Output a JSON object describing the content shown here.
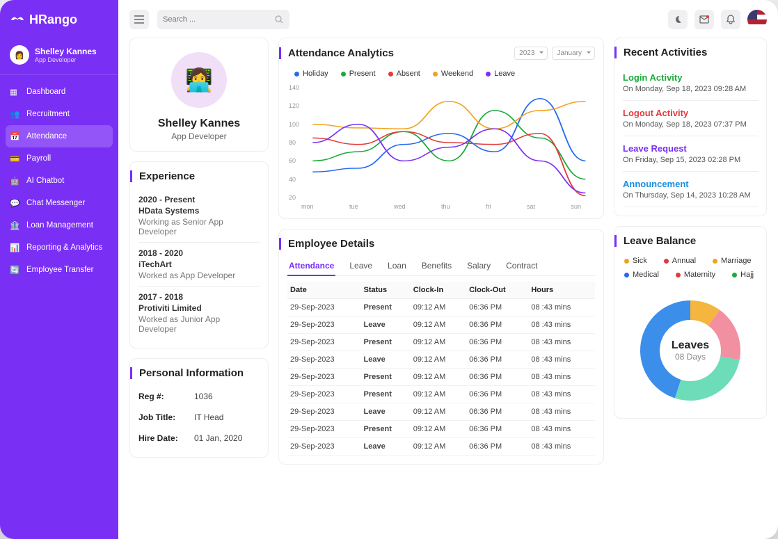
{
  "brand": "HRango",
  "user": {
    "name": "Shelley Kannes",
    "role": "App Developer"
  },
  "nav": {
    "items": [
      {
        "label": "Dashboard"
      },
      {
        "label": "Recruitment"
      },
      {
        "label": "Attendance",
        "active": true
      },
      {
        "label": "Payroll"
      },
      {
        "label": "AI Chatbot"
      },
      {
        "label": "Chat Messenger"
      },
      {
        "label": "Loan Management"
      },
      {
        "label": "Reporting & Analytics"
      },
      {
        "label": "Employee Transfer"
      }
    ]
  },
  "search": {
    "placeholder": "Search ..."
  },
  "profile": {
    "name": "Shelley Kannes",
    "role": "App Developer"
  },
  "experience": {
    "title": "Experience",
    "items": [
      {
        "dates": "2020 - Present",
        "company": "HData Systems",
        "desc": "Working as Senior App Developer"
      },
      {
        "dates": "2018 - 2020",
        "company": "iTechArt",
        "desc": "Worked as App Developer"
      },
      {
        "dates": "2017 - 2018",
        "company": "Protiviti Limited",
        "desc": "Worked as Junior App Developer"
      }
    ]
  },
  "personal": {
    "title": "Personal Information",
    "rows": [
      {
        "label": "Reg #:",
        "value": "1036"
      },
      {
        "label": "Job Title:",
        "value": "IT Head"
      },
      {
        "label": "Hire Date:",
        "value": "01 Jan, 2020"
      }
    ]
  },
  "attendance": {
    "title": "Attendance Analytics",
    "year": "2023",
    "month": "January",
    "legend": [
      {
        "label": "Holiday",
        "color": "#2668f0"
      },
      {
        "label": "Present",
        "color": "#1aaa3b"
      },
      {
        "label": "Absent",
        "color": "#e23a3a"
      },
      {
        "label": "Weekend",
        "color": "#f0a21e"
      },
      {
        "label": "Leave",
        "color": "#7a2ff5"
      }
    ]
  },
  "chart_data": {
    "type": "line",
    "categories": [
      "mon",
      "tue",
      "wed",
      "thu",
      "fri",
      "sat",
      "sun"
    ],
    "ylim": [
      20,
      140
    ],
    "yticks": [
      20,
      40,
      60,
      80,
      100,
      120,
      140
    ],
    "series": [
      {
        "name": "Holiday",
        "color": "#2668f0",
        "values": [
          48,
          52,
          78,
          90,
          70,
          128,
          60
        ]
      },
      {
        "name": "Present",
        "color": "#1aaa3b",
        "values": [
          60,
          70,
          92,
          60,
          115,
          85,
          40
        ]
      },
      {
        "name": "Absent",
        "color": "#e23a3a",
        "values": [
          85,
          78,
          92,
          80,
          78,
          90,
          22
        ]
      },
      {
        "name": "Weekend",
        "color": "#f0a21e",
        "values": [
          100,
          96,
          95,
          125,
          95,
          115,
          125
        ]
      },
      {
        "name": "Leave",
        "color": "#7a2ff5",
        "values": [
          80,
          100,
          60,
          75,
          95,
          60,
          25
        ]
      }
    ]
  },
  "details": {
    "title": "Employee Details",
    "tabs": [
      "Attendance",
      "Leave",
      "Loan",
      "Benefits",
      "Salary",
      "Contract"
    ],
    "activeTab": 0,
    "columns": [
      "Date",
      "Status",
      "Clock-In",
      "Clock-Out",
      "Hours"
    ],
    "rows": [
      {
        "date": "29-Sep-2023",
        "status": "Present",
        "in": "09:12 AM",
        "out": "06:36 PM",
        "hours": "08 :43 mins"
      },
      {
        "date": "29-Sep-2023",
        "status": "Leave",
        "in": "09:12 AM",
        "out": "06:36 PM",
        "hours": "08 :43 mins"
      },
      {
        "date": "29-Sep-2023",
        "status": "Present",
        "in": "09:12 AM",
        "out": "06:36 PM",
        "hours": "08 :43 mins"
      },
      {
        "date": "29-Sep-2023",
        "status": "Leave",
        "in": "09:12 AM",
        "out": "06:36 PM",
        "hours": "08 :43 mins"
      },
      {
        "date": "29-Sep-2023",
        "status": "Present",
        "in": "09:12 AM",
        "out": "06:36 PM",
        "hours": "08 :43 mins"
      },
      {
        "date": "29-Sep-2023",
        "status": "Present",
        "in": "09:12 AM",
        "out": "06:36 PM",
        "hours": "08 :43 mins"
      },
      {
        "date": "29-Sep-2023",
        "status": "Leave",
        "in": "09:12 AM",
        "out": "06:36 PM",
        "hours": "08 :43 mins"
      },
      {
        "date": "29-Sep-2023",
        "status": "Present",
        "in": "09:12 AM",
        "out": "06:36 PM",
        "hours": "08 :43 mins"
      },
      {
        "date": "29-Sep-2023",
        "status": "Leave",
        "in": "09:12 AM",
        "out": "06:36 PM",
        "hours": "08 :43 mins"
      }
    ]
  },
  "activities": {
    "title": "Recent Activities",
    "items": [
      {
        "title": "Login Activity",
        "color": "#1aaa3b",
        "sub": "On Monday, Sep 18, 2023  09:28 AM"
      },
      {
        "title": "Logout Activity",
        "color": "#e23a3a",
        "sub": "On Monday, Sep 18, 2023  07:37 PM"
      },
      {
        "title": "Leave Request",
        "color": "#7a2ff5",
        "sub": "On Friday, Sep 15, 2023  02:28 PM"
      },
      {
        "title": "Announcement",
        "color": "#1a8fe0",
        "sub": "On Thursday, Sep 14, 2023  10:28 AM"
      }
    ]
  },
  "leave": {
    "title": "Leave Balance",
    "center_title": "Leaves",
    "center_sub": "08 Days",
    "legend": [
      {
        "label": "Sick",
        "color": "#f0a21e"
      },
      {
        "label": "Annual",
        "color": "#e23a3a"
      },
      {
        "label": "Marriage",
        "color": "#f0a21e"
      },
      {
        "label": "Medical",
        "color": "#2668f0"
      },
      {
        "label": "Maternity",
        "color": "#e23a3a"
      },
      {
        "label": "Hajj",
        "color": "#1aaa3b"
      }
    ],
    "segments": [
      {
        "color": "#f4b63e",
        "pct": 10
      },
      {
        "color": "#f28fa0",
        "pct": 18
      },
      {
        "color": "#6ddcb8",
        "pct": 27
      },
      {
        "color": "#3b8eea",
        "pct": 45
      }
    ]
  }
}
